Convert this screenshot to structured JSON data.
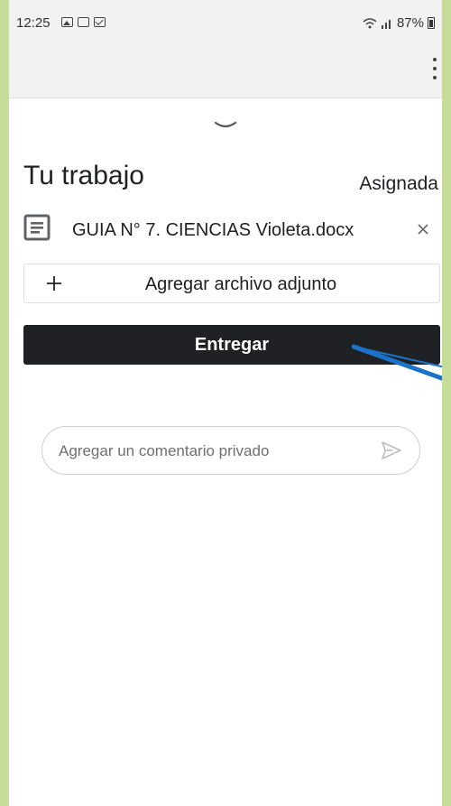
{
  "status_bar": {
    "time": "12:25",
    "battery": "87%",
    "notification_icons": [
      "image-icon",
      "keyboard-icon",
      "mail-icon"
    ]
  },
  "app_bar": {
    "menu_icon": "more-vert-icon"
  },
  "work": {
    "title": "Tu trabajo",
    "status": "Asignada",
    "attachment": {
      "file_name": "GUIA N° 7. CIENCIAS Violeta.docx",
      "icon": "document-icon",
      "remove_icon": "close-icon"
    },
    "add_attachment_label": "Agregar archivo adjunto",
    "submit_label": "Entregar"
  },
  "comment": {
    "placeholder": "Agregar un comentario privado",
    "send_icon": "send-icon"
  },
  "colors": {
    "background_frame": "#c5dc9b",
    "submit_button": "#202124",
    "annotation_arrow": "#1a73c9"
  }
}
